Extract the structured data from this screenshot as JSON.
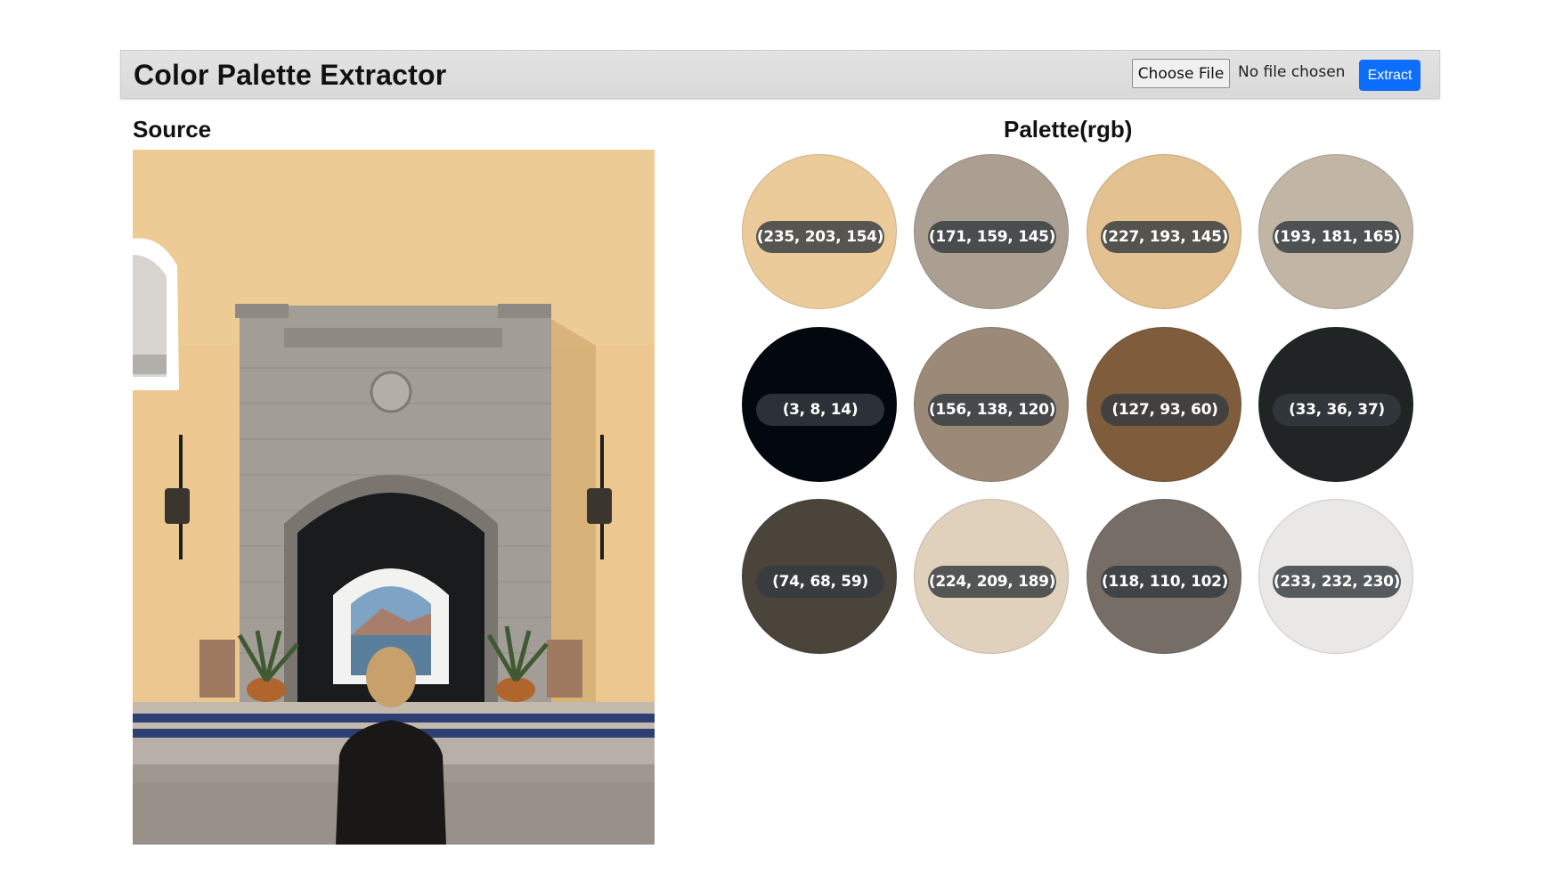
{
  "header": {
    "title": "Color Palette Extractor",
    "choose_file_label": "Choose File",
    "file_status": "No file chosen",
    "extract_label": "Extract"
  },
  "source": {
    "title": "Source"
  },
  "palette": {
    "title": "Palette(rgb)",
    "swatches": [
      {
        "label": "(235, 203, 154)",
        "color": "#ebcb9a"
      },
      {
        "label": "(171, 159, 145)",
        "color": "#ab9f91"
      },
      {
        "label": "(227, 193, 145)",
        "color": "#e3c191"
      },
      {
        "label": "(193, 181, 165)",
        "color": "#c1b5a5"
      },
      {
        "label": "(3, 8, 14)",
        "color": "#03080e"
      },
      {
        "label": "(156, 138, 120)",
        "color": "#9c8a78"
      },
      {
        "label": "(127, 93, 60)",
        "color": "#7f5d3c"
      },
      {
        "label": "(33, 36, 37)",
        "color": "#212425"
      },
      {
        "label": "(74, 68, 59)",
        "color": "#4a443b"
      },
      {
        "label": "(224, 209, 189)",
        "color": "#e0d1bd"
      },
      {
        "label": "(118, 110, 102)",
        "color": "#766e66"
      },
      {
        "label": "(233, 232, 230)",
        "color": "#e9e8e6"
      }
    ]
  },
  "colors": {
    "extract_button": "#0d6efd",
    "header_background": "#dedede"
  }
}
